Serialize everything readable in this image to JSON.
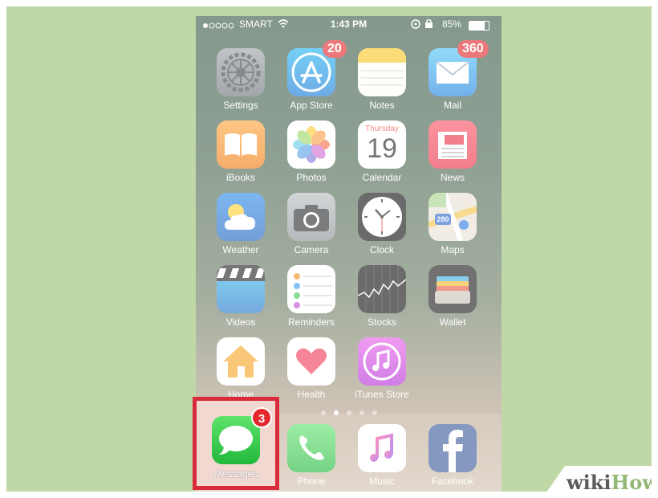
{
  "status_bar": {
    "carrier": "SMART",
    "time": "1:43 PM",
    "battery": "85%"
  },
  "apps": [
    {
      "label": "Settings",
      "icon": "settings-gear-icon"
    },
    {
      "label": "App Store",
      "icon": "app-store-icon",
      "badge": "20"
    },
    {
      "label": "Notes",
      "icon": "notes-icon"
    },
    {
      "label": "Mail",
      "icon": "mail-envelope-icon",
      "badge": "360"
    },
    {
      "label": "iBooks",
      "icon": "book-icon"
    },
    {
      "label": "Photos",
      "icon": "photos-flower-icon"
    },
    {
      "label": "Calendar",
      "icon": "calendar-icon",
      "day": "Thursday",
      "date": "19"
    },
    {
      "label": "News",
      "icon": "news-icon"
    },
    {
      "label": "Weather",
      "icon": "weather-cloud-sun-icon"
    },
    {
      "label": "Camera",
      "icon": "camera-icon"
    },
    {
      "label": "Clock",
      "icon": "clock-icon"
    },
    {
      "label": "Maps",
      "icon": "map-icon",
      "shield": "280"
    },
    {
      "label": "Videos",
      "icon": "clapperboard-icon"
    },
    {
      "label": "Reminders",
      "icon": "reminders-list-icon"
    },
    {
      "label": "Stocks",
      "icon": "stocks-chart-icon"
    },
    {
      "label": "Wallet",
      "icon": "wallet-icon"
    },
    {
      "label": "Home",
      "icon": "house-icon"
    },
    {
      "label": "Health",
      "icon": "heart-icon"
    },
    {
      "label": "iTunes Store",
      "icon": "music-note-icon"
    }
  ],
  "dock": [
    {
      "label": "Messages",
      "icon": "speech-bubble-icon",
      "badge": "3"
    },
    {
      "label": "Phone",
      "icon": "phone-handset-icon"
    },
    {
      "label": "Music",
      "icon": "music-note-icon"
    },
    {
      "label": "Facebook",
      "icon": "facebook-f-icon"
    }
  ],
  "watermark": {
    "part1": "wiki",
    "part2": "How"
  },
  "colors": {
    "background": "#bfd8a6",
    "highlight": "#d92b3a",
    "badge": "#e3262b"
  }
}
